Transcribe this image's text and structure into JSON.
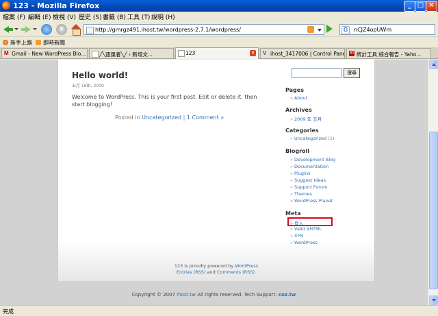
{
  "window": {
    "title": "123 - Mozilla Firefox"
  },
  "menu": [
    "檔案 (F)",
    "編輯 (E)",
    "檢視 (V)",
    "歷史 (S)",
    "書籤 (B)",
    "工具 (T)",
    "說明 (H)"
  ],
  "nav": {
    "url": "http://gmrgz491.ihost.tw/wordpress-2.7.1/wordpress/",
    "search_value": "nCJZ4opUWm"
  },
  "bookmarks": [
    {
      "label": "新手上路",
      "icon": "firefox-icon"
    },
    {
      "label": "即時新聞",
      "icon": "rss-icon"
    }
  ],
  "tabs": [
    {
      "label": "Gmail - New WordPress Blo...",
      "icon": "gmail-icon"
    },
    {
      "label": "╱╲逐風者╲╱ › 新增文...",
      "icon": "page-icon"
    },
    {
      "label": "123",
      "icon": "page-icon"
    },
    {
      "label": "ihost_3417006 | Control Panel",
      "icon": "ihost-icon"
    },
    {
      "label": "統計工具 綜合報告 - Yaho...",
      "icon": "yahoo-icon"
    }
  ],
  "colors": {
    "link": "#2b6fb6",
    "highlight_box": "#e8001c"
  },
  "post": {
    "title": "Hello world!",
    "date": "五月 16th, 2009",
    "body": "Welcome to WordPress. This is your first post. Edit or delete it, then start blogging!",
    "posted_in_label": "Posted in",
    "category": "Uncategorized",
    "separator": "|",
    "comments": "1 Comment »"
  },
  "sidebar": {
    "search_button": "搜尋",
    "pages": {
      "title": "Pages",
      "items": [
        "About"
      ]
    },
    "archives": {
      "title": "Archives",
      "items": [
        "2009 年 五月"
      ]
    },
    "categories": {
      "title": "Categories",
      "item": "Uncategorized",
      "count": "(1)"
    },
    "blogroll": {
      "title": "Blogroll",
      "items": [
        "Development Blog",
        "Documentation",
        "Plugins",
        "Suggest Ideas",
        "Support Forum",
        "Themes",
        "WordPress Planet"
      ]
    },
    "meta": {
      "title": "Meta",
      "items": [
        "登入",
        "Valid XHTML",
        "XFN",
        "WordPress"
      ]
    }
  },
  "page_footer": {
    "line1_prefix": "123 is proudly powered by",
    "line1_link": "WordPress",
    "entries": "Entries (RSS)",
    "and": "and",
    "comments": "Comments (RSS)."
  },
  "site_footer": {
    "prefix": "Copyright © 2007",
    "host": "ihost.tw",
    "middle": "All rights reserved. Tech Support:",
    "support": "coz.tw"
  },
  "status": "完成"
}
